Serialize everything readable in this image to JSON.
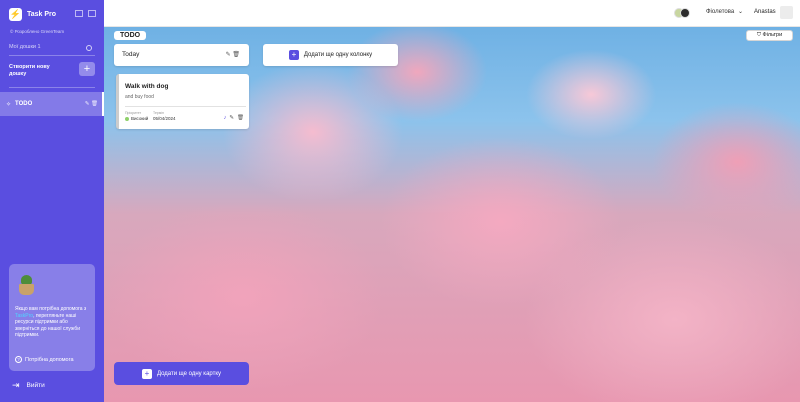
{
  "app": {
    "name": "Task Pro",
    "powered_by": "© Розроблено GreenTeam"
  },
  "sidebar": {
    "boards_title": "Мої дошки 1",
    "create_label": "Створити нову дошку",
    "create_button": "+",
    "boards": [
      {
        "label": "TODO"
      }
    ],
    "help": {
      "text_before": "Якщо вам потрібна допомога з",
      "link_text": "TaskPro",
      "text_after": ", перегляньте наші ресурси підтримки або зверніться до нашої служби підтримки.",
      "button_label": "Потрібна допомога"
    },
    "logout_label": "Вийти"
  },
  "header": {
    "theme_label": "Фіолетова",
    "username": "Anastas"
  },
  "board": {
    "title": "TODO",
    "filters_label": "Фільтри",
    "columns": [
      {
        "title": "Today",
        "cards": [
          {
            "title": "Walk with dog",
            "description": "and buy food",
            "priority_label": "Пріоритет",
            "priority": "Високий",
            "deadline_label": "Термін",
            "deadline": "05/04/2024"
          }
        ],
        "add_card_label": "Додати ще одну картку"
      }
    ],
    "add_column_label": "Додати ще одну колонку"
  },
  "colors": {
    "accent": "#5a4ee0",
    "priority_high": "#8fd16a"
  }
}
